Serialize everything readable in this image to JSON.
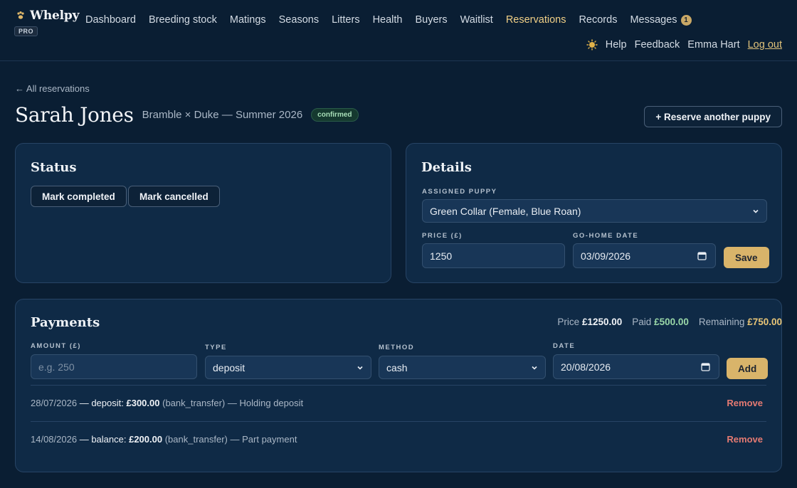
{
  "app": {
    "name": "Whelpy",
    "badge": "PRO"
  },
  "nav": {
    "items": [
      {
        "label": "Dashboard"
      },
      {
        "label": "Breeding stock"
      },
      {
        "label": "Matings"
      },
      {
        "label": "Seasons"
      },
      {
        "label": "Litters"
      },
      {
        "label": "Health"
      },
      {
        "label": "Buyers"
      },
      {
        "label": "Waitlist"
      },
      {
        "label": "Reservations",
        "active": true
      },
      {
        "label": "Records"
      },
      {
        "label": "Messages",
        "badge": "1"
      }
    ]
  },
  "utility": {
    "theme_icon": "sun-icon",
    "help": "Help",
    "feedback": "Feedback",
    "user": "Emma Hart",
    "logout": "Log out"
  },
  "page": {
    "back_link": "← All reservations",
    "title": "Sarah Jones",
    "subtitle": "Bramble × Duke — Summer 2026",
    "status": "confirmed",
    "reserve_button": "+ Reserve another puppy"
  },
  "status_card": {
    "title": "Status",
    "mark_completed": "Mark completed",
    "mark_cancelled": "Mark cancelled"
  },
  "details_card": {
    "title": "Details",
    "assigned_puppy_label": "Assigned puppy",
    "assigned_puppy_value": "Green Collar (Female, Blue Roan)",
    "price_label": "Price (£)",
    "price_value": "1250",
    "go_home_label": "Go-home date",
    "go_home_value": "03/09/2026",
    "save": "Save"
  },
  "payments": {
    "title": "Payments",
    "summary": {
      "price_label": "Price",
      "price": "£1250.00",
      "paid_label": "Paid",
      "paid": "£500.00",
      "remaining_label": "Remaining",
      "remaining": "£750.00"
    },
    "form": {
      "amount_label": "Amount (£)",
      "amount_placeholder": "e.g. 250",
      "type_label": "Type",
      "type_value": "deposit",
      "method_label": "Method",
      "method_value": "cash",
      "date_label": "Date",
      "date_value": "20/08/2026",
      "add": "Add"
    },
    "rows": [
      {
        "date": "28/07/2026",
        "sep1": " — ",
        "type": "deposit:",
        "amount": "£300.00",
        "method": "(bank_transfer)",
        "note": "— Holding deposit",
        "remove": "Remove"
      },
      {
        "date": "14/08/2026",
        "sep1": " — ",
        "type": "balance:",
        "amount": "£200.00",
        "method": "(bank_transfer)",
        "note": "— Part payment",
        "remove": "Remove"
      }
    ]
  },
  "colors": {
    "background": "#0a1e33",
    "card": "#0f2a46",
    "accent": "#d9b46a",
    "paid": "#9ad8a8",
    "remaining": "#e8c577",
    "remove": "#e57a72"
  }
}
